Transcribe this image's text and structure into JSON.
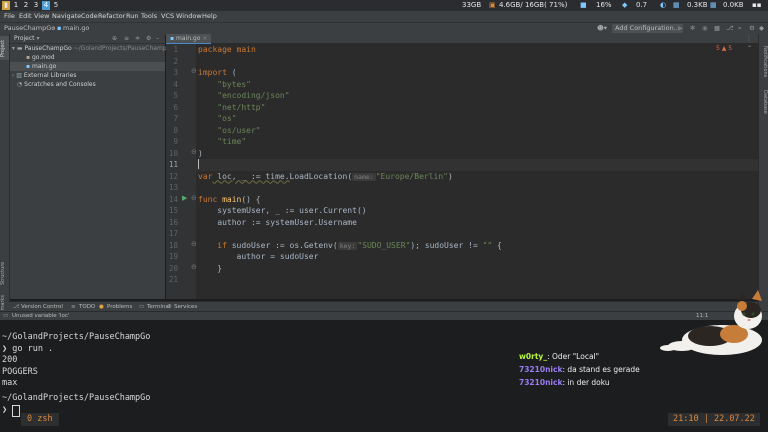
{
  "sysbar": {
    "workspaces": [
      "1",
      "2",
      "3",
      "4",
      "5"
    ],
    "active_workspace": "3",
    "disk": "33GB",
    "memory": "4.6GB/ 16GB( 71%)",
    "cpu": "16%",
    "load": "0.7",
    "net_up": "0.3KB",
    "net_down": "0.0KB"
  },
  "menubar": {
    "items": [
      "File",
      "Edit",
      "View",
      "Navigate",
      "Code",
      "Refactor",
      "Run",
      "Tools",
      "VCS",
      "Window",
      "Help"
    ]
  },
  "navbar": {
    "project": "PauseChampGo",
    "file": "main.go",
    "add_config": "Add Configuration..."
  },
  "project_panel": {
    "title": "Project",
    "root": "PauseChampGo",
    "root_path": "~/GolandProjects/PauseChampGo",
    "files": [
      "go.mod",
      "main.go"
    ],
    "external": "External Libraries",
    "scratches": "Scratches and Consoles"
  },
  "editor": {
    "tab": "main.go",
    "inspection": "5  ▲ 5",
    "line_numbers": [
      "1",
      "2",
      "3",
      "4",
      "5",
      "6",
      "7",
      "8",
      "9",
      "10",
      "11",
      "12",
      "13",
      "14",
      "15",
      "16",
      "17",
      "18",
      "19",
      "20",
      "21"
    ],
    "lines": {
      "l1": "package main",
      "l3a": "import",
      "l3b": " (",
      "l4": "    \"bytes\"",
      "l5": "    \"encoding/json\"",
      "l6": "    \"net/http\"",
      "l7": "    \"os\"",
      "l8": "    \"os/user\"",
      "l9": "    \"time\"",
      "l10": ")",
      "l12a": "var",
      "l12b": " loc, _ := time.",
      "l12c": "LoadLocation(",
      "l12hint": "name:",
      "l12str": "\"Europe/Berlin\"",
      "l12d": ")",
      "l14a": "func",
      "l14b": " main",
      "l14c": "() {",
      "l15": "    systemUser, _ := user.Current()",
      "l16": "    author := systemUser.Username",
      "l18a": "    if",
      "l18b": " sudoUser := os.Getenv(",
      "l18hint": "key:",
      "l18str": "\"SUDO_USER\"",
      "l18c": "); sudoUser != ",
      "l18str2": "\"\"",
      "l18d": " {",
      "l19": "        author = sudoUser",
      "l20": "    }"
    }
  },
  "toolwindows": {
    "version_control": "Version Control",
    "todo": "TODO",
    "problems": "Problems",
    "terminal": "Terminal",
    "services": "Services"
  },
  "left_strip": {
    "project": "Project",
    "structure": "Structure",
    "bookmarks": "Bookmarks"
  },
  "right_strip": {
    "notifications": "Notifications",
    "database": "Database"
  },
  "status": {
    "message": "Unused variable 'loc'",
    "position": "11:1"
  },
  "terminal": {
    "lines": [
      "~/GolandProjects/PauseChampGo",
      "❯ go run .",
      "200",
      "POGGERS",
      "max",
      "",
      "~/GolandProjects/PauseChampGo",
      "❯ "
    ],
    "tmux_window": "0  zsh",
    "clock": "21:10",
    "date": "22.07.22"
  },
  "chat": [
    {
      "user": "w0rty_",
      "text": ": Oder \"Local\"",
      "color": "#b9f542"
    },
    {
      "user": "73210nick",
      "text": ": da stand es gerade",
      "color": "#9b7cf5"
    },
    {
      "user": "73210nick",
      "text": ": in der doku",
      "color": "#9b7cf5"
    }
  ]
}
